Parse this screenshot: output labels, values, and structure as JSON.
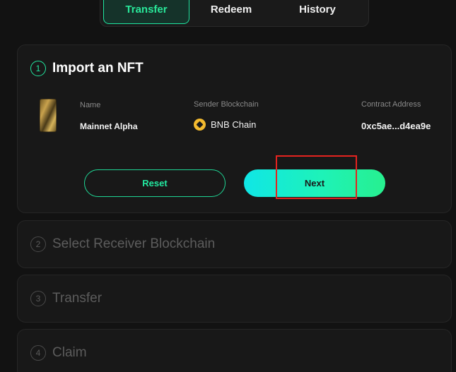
{
  "tabs": {
    "transfer": "Transfer",
    "redeem": "Redeem",
    "history": "History"
  },
  "steps": [
    {
      "number": "1",
      "title": "Import an NFT"
    },
    {
      "number": "2",
      "title": "Select Receiver Blockchain"
    },
    {
      "number": "3",
      "title": "Transfer"
    },
    {
      "number": "4",
      "title": "Claim"
    }
  ],
  "nft": {
    "name_label": "Name",
    "name_value": "Mainnet Alpha",
    "chain_label": "Sender Blockchain",
    "chain_value": "BNB Chain",
    "address_label": "Contract Address",
    "address_value": "0xc5ae...d4ea9e"
  },
  "buttons": {
    "reset": "Reset",
    "next": "Next"
  },
  "colors": {
    "accent": "#22e8a0",
    "highlight": "#e5231f"
  }
}
